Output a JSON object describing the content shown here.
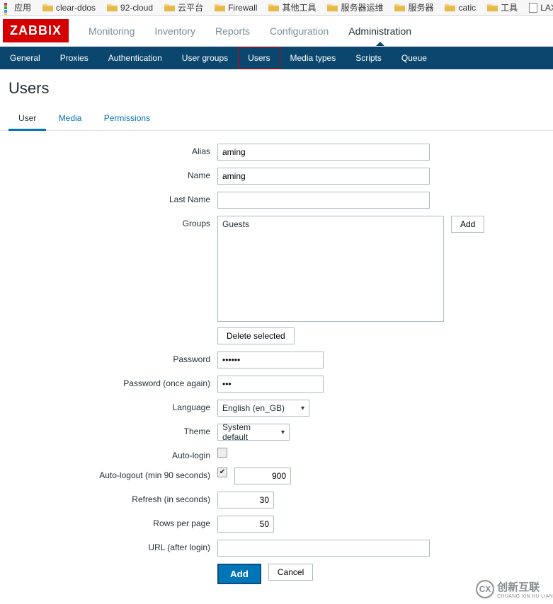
{
  "bookmarks": {
    "apps_label": "应用",
    "items": [
      "clear-ddos",
      "92-cloud",
      "云平台",
      "Firewall",
      "其他工具",
      "服务器运维",
      "服务器",
      "catic",
      "工具"
    ],
    "file_item": "LAX"
  },
  "header": {
    "logo": "ZABBIX",
    "main_nav": {
      "monitoring": "Monitoring",
      "inventory": "Inventory",
      "reports": "Reports",
      "configuration": "Configuration",
      "administration": "Administration"
    },
    "sub_nav": {
      "general": "General",
      "proxies": "Proxies",
      "authentication": "Authentication",
      "user_groups": "User groups",
      "users": "Users",
      "media_types": "Media types",
      "scripts": "Scripts",
      "queue": "Queue"
    }
  },
  "page_title": "Users",
  "tabs": {
    "user": "User",
    "media": "Media",
    "permissions": "Permissions"
  },
  "form": {
    "labels": {
      "alias": "Alias",
      "name": "Name",
      "last_name": "Last Name",
      "groups": "Groups",
      "password": "Password",
      "password2": "Password (once again)",
      "language": "Language",
      "theme": "Theme",
      "auto_login": "Auto-login",
      "auto_logout": "Auto-logout (min 90 seconds)",
      "refresh": "Refresh (in seconds)",
      "rows": "Rows per page",
      "url": "URL (after login)"
    },
    "values": {
      "alias": "aming",
      "name": "aming",
      "last_name": "",
      "groups_item": "Guests",
      "password": "••••••",
      "password2": "•••",
      "language": "English (en_GB)",
      "theme": "System default",
      "auto_login_checked": false,
      "auto_logout_checked": true,
      "auto_logout_value": "900",
      "refresh": "30",
      "rows": "50",
      "url": ""
    },
    "buttons": {
      "add_group": "Add",
      "delete_selected": "Delete selected",
      "add": "Add",
      "cancel": "Cancel"
    }
  },
  "watermark": {
    "logo": "CX",
    "line1": "创新互联",
    "line2": "CHUANG XIN HU LIAN"
  }
}
